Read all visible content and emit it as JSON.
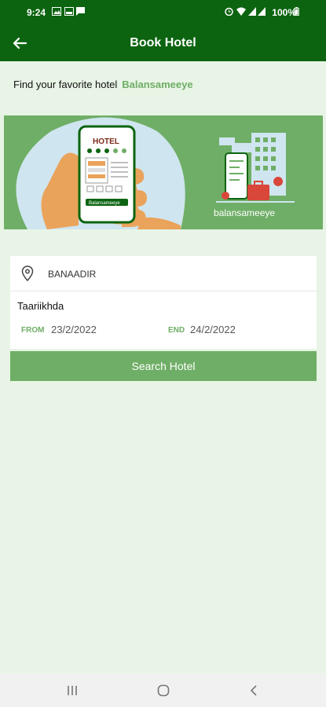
{
  "status_bar": {
    "time": "9:24",
    "battery": "100%"
  },
  "appbar": {
    "title": "Book Hotel",
    "back_icon": "arrow-left-icon"
  },
  "tagline": {
    "text": "Find your favorite hotel",
    "brand": "Balansameeye"
  },
  "banner": {
    "hotel_sign": "HOTEL",
    "badge_text": "Balansameeye",
    "caption": "balansameeye",
    "colors": {
      "bg": "#6fae66",
      "accent": "#0c6410",
      "circle": "#cfe5ef",
      "hand": "#eaa35a"
    }
  },
  "form": {
    "location": {
      "icon": "map-pin-icon",
      "value": "BANAADIR"
    },
    "dates_label": "Taariikhda",
    "from_label": "FROM",
    "from_value": "23/2/2022",
    "end_label": "END",
    "end_value": "24/2/2022"
  },
  "search_button": {
    "label": "Search Hotel"
  },
  "nav": {
    "recents_icon": "recents-icon",
    "home_icon": "home-circle-icon",
    "back_icon": "chevron-left-icon"
  }
}
